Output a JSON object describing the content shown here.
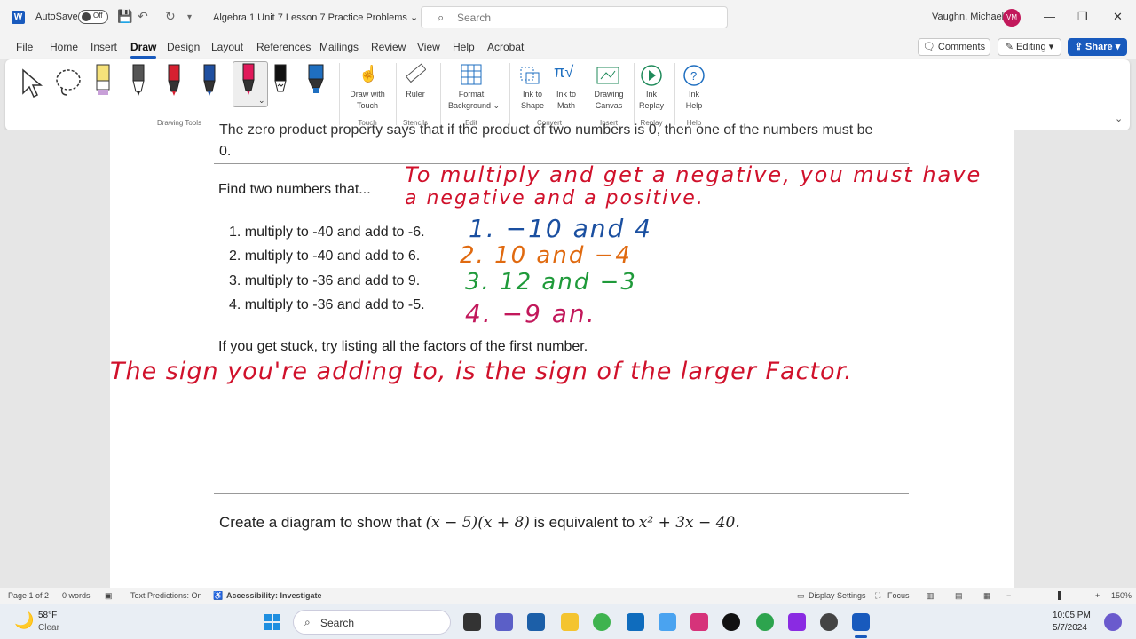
{
  "titlebar": {
    "app_badge": "W",
    "autosave_label": "AutoSave",
    "autosave_state": "Off",
    "doc_title": "Algebra 1 Unit 7 Lesson 7 Practice Problems",
    "search_placeholder": "Search",
    "user_name": "Vaughn, Michael",
    "user_initials": "VM"
  },
  "menu": {
    "tabs": [
      "File",
      "Home",
      "Insert",
      "Draw",
      "Design",
      "Layout",
      "References",
      "Mailings",
      "Review",
      "View",
      "Help",
      "Acrobat"
    ],
    "active_tab": "Draw",
    "comments_label": "Comments",
    "editing_label": "Editing",
    "share_label": "Share"
  },
  "ribbon": {
    "groups": {
      "drawing_tools": "Drawing Tools",
      "touch": "Touch",
      "stencils": "Stencils",
      "edit": "Edit",
      "convert": "Convert",
      "insert": "Insert",
      "replay": "Replay",
      "help": "Help"
    },
    "buttons": {
      "draw_with_touch_1": "Draw with",
      "draw_with_touch_2": "Touch",
      "ruler": "Ruler",
      "format_bg_1": "Format",
      "format_bg_2": "Background",
      "ink_shape_1": "Ink to",
      "ink_shape_2": "Shape",
      "ink_math_1": "Ink to",
      "ink_math_2": "Math",
      "drawing_canvas_1": "Drawing",
      "drawing_canvas_2": "Canvas",
      "ink_replay_1": "Ink",
      "ink_replay_2": "Replay",
      "ink_help_1": "Ink",
      "ink_help_2": "Help"
    },
    "pen_colors": [
      "#f6e27a",
      "#333333",
      "#d62030",
      "#1f4fa0",
      "#e0195a",
      "#111111",
      "#1f6fc0"
    ]
  },
  "document": {
    "top_text_line1": "The zero product property says that if the product of two numbers is 0, then one of the numbers must be",
    "top_text_line2": "0.",
    "find_prompt": "Find two numbers that...",
    "items": [
      "1. multiply to -40 and add to -6.",
      "2. multiply to -40 and add to 6.",
      "3. multiply to -36 and add to 9.",
      "4. multiply to -36 and add to -5."
    ],
    "hint": "If you get stuck, try listing all the factors of the first number.",
    "diagram_prompt_pre": "Create a diagram to show that ",
    "diagram_expr1": "(x − 5)(x + 8)",
    "diagram_mid": " is equivalent to ",
    "diagram_expr2": "x² + 3x − 40."
  },
  "ink": {
    "note_line1": "To multiply and get a negative, you must have",
    "note_line2": "a negative and a positive.",
    "answer1": "1. −10  and 4",
    "answer2": "2.  10  and −4",
    "answer3": "3. 12  and −3",
    "answer4": "4. −9  an.",
    "rule_note": "The sign you're adding to, is the sign of the larger Factor.",
    "colors": {
      "red": "#d0112b",
      "blue": "#1a4fa0",
      "orange": "#e06a10",
      "green": "#1f9a3a",
      "magenta": "#c2185b"
    }
  },
  "status": {
    "page": "Page 1 of 2",
    "words": "0 words",
    "predictions": "Text Predictions: On",
    "accessibility": "Accessibility: Investigate",
    "display": "Display Settings",
    "focus": "Focus",
    "zoom": "150%"
  },
  "taskbar": {
    "weather_temp": "58°F",
    "weather_desc": "Clear",
    "search_label": "Search",
    "time": "10:05 PM",
    "date": "5/7/2024"
  }
}
